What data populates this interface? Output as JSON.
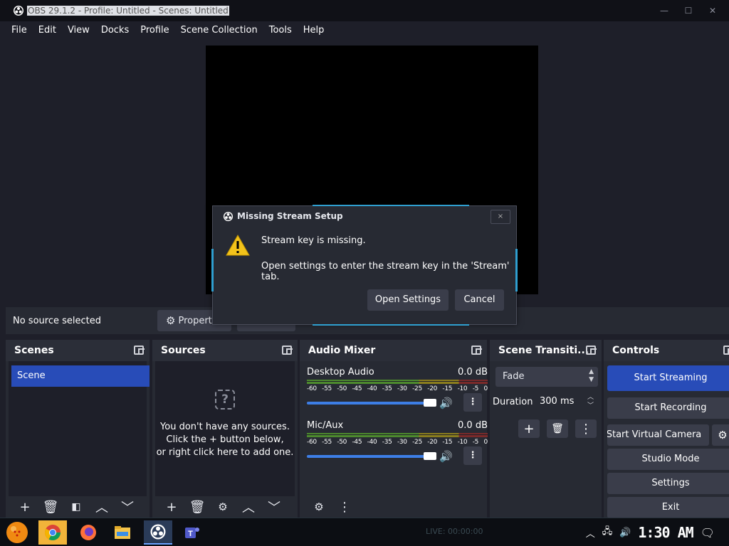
{
  "window": {
    "title": "OBS 29.1.2 - Profile: Untitled - Scenes: Untitled",
    "minimize": "—",
    "maximize": "☐",
    "close": "✕"
  },
  "menu": [
    "File",
    "Edit",
    "View",
    "Docks",
    "Profile",
    "Scene Collection",
    "Tools",
    "Help"
  ],
  "context_bar": {
    "no_source": "No source selected",
    "properties": "Properties"
  },
  "docks": {
    "scenes": {
      "title": "Scenes",
      "items": [
        "Scene"
      ]
    },
    "sources": {
      "title": "Sources",
      "empty_line1": "You don't have any sources.",
      "empty_line2": "Click the + button below,",
      "empty_line3": "or right click here to add one."
    },
    "audio_mixer": {
      "title": "Audio Mixer",
      "channels": [
        {
          "name": "Desktop Audio",
          "level": "0.0 dB",
          "volume_fraction": 1.0
        },
        {
          "name": "Mic/Aux",
          "level": "0.0 dB",
          "volume_fraction": 1.0
        }
      ],
      "ticks": [
        "-60",
        "-55",
        "-50",
        "-45",
        "-40",
        "-35",
        "-30",
        "-25",
        "-20",
        "-15",
        "-10",
        "-5",
        "0"
      ]
    },
    "transitions": {
      "title": "Scene Transiti...",
      "selected": "Fade",
      "duration_label": "Duration",
      "duration_value": "300 ms"
    },
    "controls": {
      "title": "Controls",
      "start_streaming": "Start Streaming",
      "start_recording": "Start Recording",
      "start_virtual_camera": "Start Virtual Camera",
      "studio_mode": "Studio Mode",
      "settings": "Settings",
      "exit": "Exit"
    }
  },
  "dialog": {
    "title": "Missing Stream Setup",
    "message1": "Stream key is missing.",
    "message2": "Open settings to enter the stream key in the 'Stream' tab.",
    "open_settings": "Open Settings",
    "cancel": "Cancel",
    "close": "×"
  },
  "taskbar": {
    "clock": "1:30 AM",
    "live": "LIVE: 00:00:00"
  },
  "colors": {
    "accent": "#284cb8",
    "background": "#1e1f29",
    "dock": "#272a33"
  }
}
